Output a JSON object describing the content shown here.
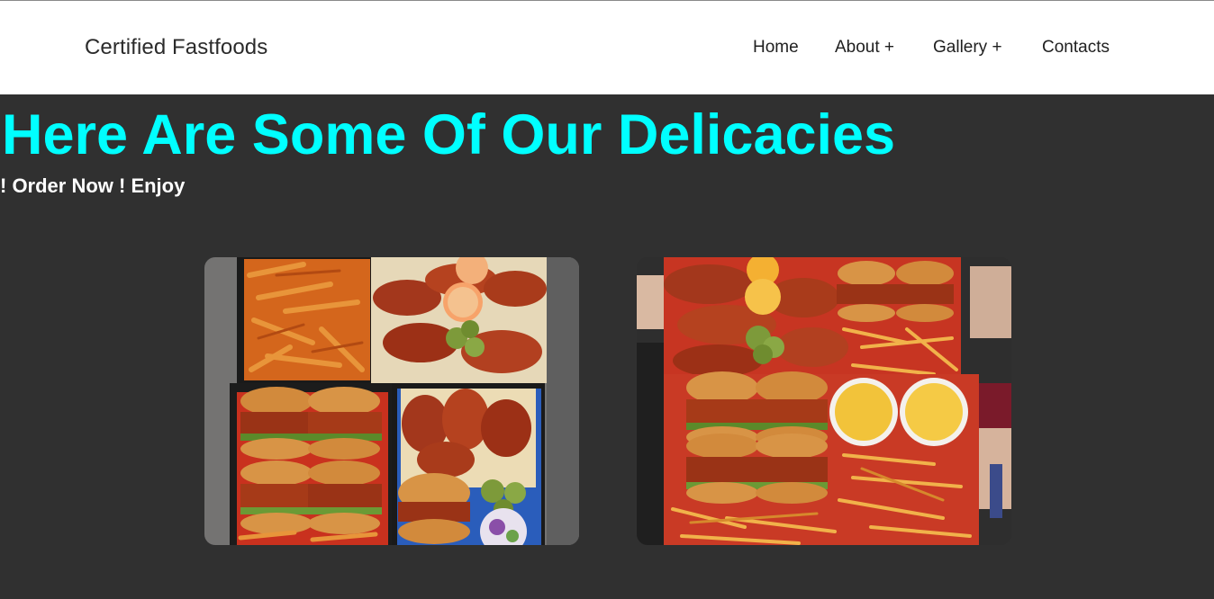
{
  "brand": {
    "name": "Certified Fastfoods"
  },
  "nav": {
    "items": [
      {
        "label": "Home"
      },
      {
        "label": "About +"
      },
      {
        "label": "Gallery +"
      },
      {
        "label": "Contacts"
      }
    ]
  },
  "hero": {
    "title": "Here Are Some Of Our Delicacies",
    "subtitle": "! Order Now ! Enjoy"
  },
  "colors": {
    "page_background": "#303030",
    "header_background": "#ffffff",
    "title_color": "#00ffff",
    "subtitle_color": "#ffffff"
  },
  "gallery": {
    "images": [
      {
        "name": "food-platter-photo-1"
      },
      {
        "name": "food-platter-photo-2"
      }
    ]
  }
}
